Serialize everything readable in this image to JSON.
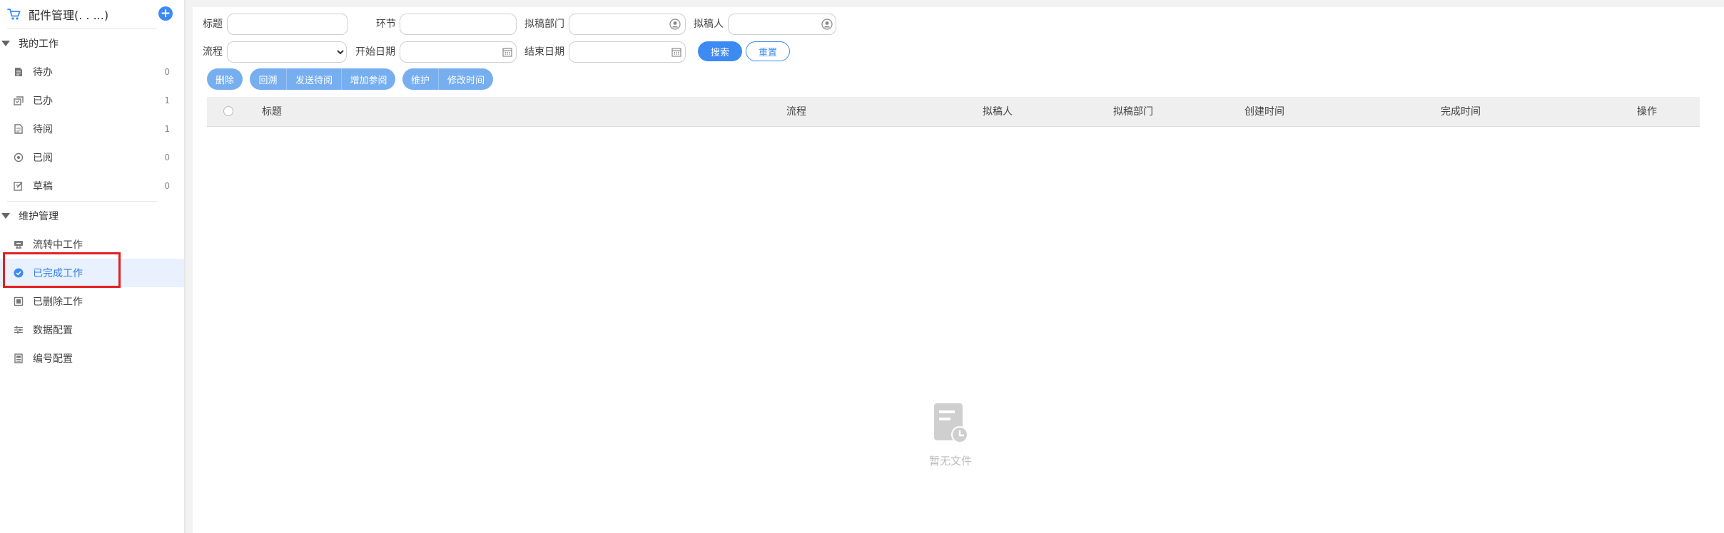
{
  "sidebar": {
    "title": "配件管理(.  . ...)",
    "add_label": "+",
    "groups": [
      {
        "label": "我的工作",
        "items": [
          {
            "label": "待办",
            "count": "0"
          },
          {
            "label": "已办",
            "count": "1"
          },
          {
            "label": "待阅",
            "count": "1"
          },
          {
            "label": "已阅",
            "count": "0"
          },
          {
            "label": "草稿",
            "count": "0"
          }
        ]
      },
      {
        "label": "维护管理",
        "items": [
          {
            "label": "流转中工作"
          },
          {
            "label": "已完成工作",
            "active": true
          },
          {
            "label": "已删除工作"
          },
          {
            "label": "数据配置"
          },
          {
            "label": "编号配置"
          }
        ]
      }
    ]
  },
  "filters": {
    "title_label": "标题",
    "title_value": "",
    "node_label": "环节",
    "node_value": "",
    "dept_label": "拟稿部门",
    "dept_value": "",
    "drafter_label": "拟稿人",
    "drafter_value": "",
    "process_label": "流程",
    "process_value": "",
    "start_label": "开始日期",
    "start_value": "",
    "end_label": "结束日期",
    "end_value": "",
    "search_label": "搜索",
    "reset_label": "重置"
  },
  "toolbar": {
    "delete_label": "删除",
    "recall_label": "回溯",
    "send_read_label": "发送待阅",
    "add_reader_label": "增加参阅",
    "maintain_label": "维护",
    "modify_time_label": "修改时间"
  },
  "table": {
    "columns": [
      "标题",
      "流程",
      "拟稿人",
      "拟稿部门",
      "创建时间",
      "完成时间",
      "操作"
    ]
  },
  "empty": {
    "text": "暂无文件"
  },
  "colors": {
    "accent": "#3d8bf2",
    "button_group": "#76aef0",
    "active_bg": "#e8f1fd",
    "highlight": "#e02020"
  }
}
